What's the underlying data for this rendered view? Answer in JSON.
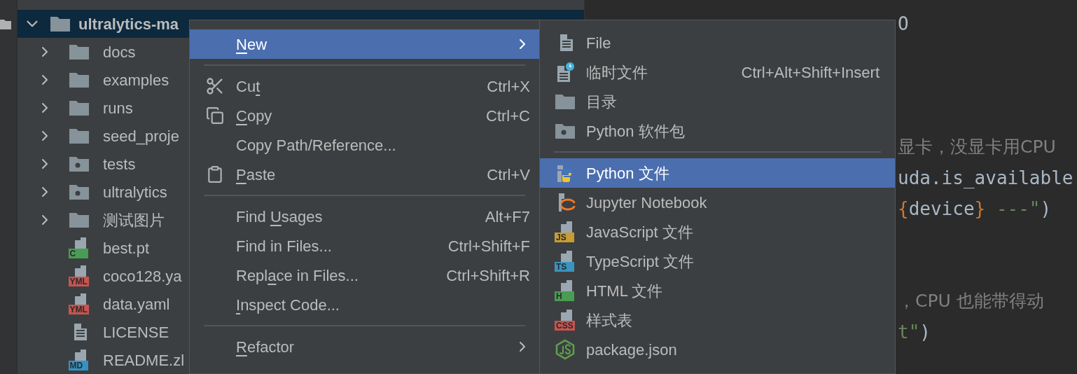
{
  "tree": {
    "root": {
      "label": "ultralytics-ma",
      "expanded": true,
      "selected": true
    },
    "children": [
      {
        "label": "docs",
        "kind": "folder",
        "expanded": false
      },
      {
        "label": "examples",
        "kind": "folder",
        "expanded": false
      },
      {
        "label": "runs",
        "kind": "folder",
        "expanded": false
      },
      {
        "label": "seed_proje",
        "kind": "folder",
        "expanded": false
      },
      {
        "label": "tests",
        "kind": "package",
        "expanded": false
      },
      {
        "label": "ultralytics",
        "kind": "package",
        "expanded": false
      },
      {
        "label": "测试图片",
        "kind": "folder",
        "expanded": false
      },
      {
        "label": "best.pt",
        "kind": "badged",
        "badge": "C",
        "color": "#499c54"
      },
      {
        "label": "coco128.ya",
        "kind": "badged",
        "badge": "YML",
        "color": "#c75450"
      },
      {
        "label": "data.yaml",
        "kind": "badged",
        "badge": "YML",
        "color": "#c75450"
      },
      {
        "label": "LICENSE",
        "kind": "text"
      },
      {
        "label": "README.zl",
        "kind": "badged",
        "badge": "MD",
        "color": "#3592c4"
      }
    ]
  },
  "editor": {
    "lines": [
      [
        {
          "text": "O",
          "kind": "plain"
        }
      ],
      [
        {
          "text": "显卡，没显卡用CPU",
          "kind": "comment"
        }
      ],
      [
        {
          "text": "uda.is_available",
          "kind": "plain"
        }
      ],
      [
        {
          "text": "{",
          "kind": "brace"
        },
        {
          "text": "device",
          "kind": "plain"
        },
        {
          "text": "}",
          "kind": "brace"
        },
        {
          "text": " ---\"",
          "kind": "string"
        },
        {
          "text": ")",
          "kind": "plain"
        }
      ],
      [
        {
          "text": "，CPU 也能带得动",
          "kind": "comment"
        }
      ],
      [
        {
          "text": "t\"",
          "kind": "string"
        },
        {
          "text": ")",
          "kind": "plain"
        }
      ]
    ]
  },
  "context_menu": [
    {
      "kind": "submenu",
      "label": [
        {
          "text": "N",
          "underlined": true
        },
        {
          "text": "ew",
          "underlined": false
        }
      ],
      "selected": true
    },
    {
      "kind": "separator"
    },
    {
      "kind": "cut",
      "label": [
        {
          "text": "Cu",
          "underlined": false
        },
        {
          "text": "t",
          "underlined": true
        }
      ],
      "shortcut": "Ctrl+X",
      "selected": false
    },
    {
      "kind": "copy",
      "label": [
        {
          "text": "C",
          "underlined": true
        },
        {
          "text": "opy",
          "underlined": false
        }
      ],
      "shortcut": "Ctrl+C",
      "selected": false
    },
    {
      "kind": "plain",
      "label": [
        {
          "text": "Copy Path/Reference...",
          "underlined": false
        }
      ],
      "selected": false
    },
    {
      "kind": "paste",
      "label": [
        {
          "text": "P",
          "underlined": true
        },
        {
          "text": "aste",
          "underlined": false
        }
      ],
      "shortcut": "Ctrl+V",
      "selected": false
    },
    {
      "kind": "separator"
    },
    {
      "kind": "plain",
      "label": [
        {
          "text": "Find ",
          "underlined": false
        },
        {
          "text": "U",
          "underlined": true
        },
        {
          "text": "sages",
          "underlined": false
        }
      ],
      "shortcut": "Alt+F7",
      "selected": false
    },
    {
      "kind": "plain",
      "label": [
        {
          "text": "Find in Files...",
          "underlined": false
        }
      ],
      "shortcut": "Ctrl+Shift+F",
      "selected": false
    },
    {
      "kind": "plain",
      "label": [
        {
          "text": "Repl",
          "underlined": false
        },
        {
          "text": "a",
          "underlined": true
        },
        {
          "text": "ce in Files...",
          "underlined": false
        }
      ],
      "shortcut": "Ctrl+Shift+R",
      "selected": false
    },
    {
      "kind": "plain",
      "label": [
        {
          "text": "I",
          "underlined": true
        },
        {
          "text": "nspect Code...",
          "underlined": false
        }
      ],
      "selected": false
    },
    {
      "kind": "separator"
    },
    {
      "kind": "submenu",
      "label": [
        {
          "text": "R",
          "underlined": true
        },
        {
          "text": "efactor",
          "underlined": false
        }
      ],
      "selected": false
    }
  ],
  "new_submenu": [
    {
      "kind": "file",
      "label": "File",
      "selected": false
    },
    {
      "kind": "scratch",
      "label": "临时文件",
      "shortcut": "Ctrl+Alt+Shift+Insert",
      "selected": false
    },
    {
      "kind": "directory",
      "label": "目录",
      "selected": false
    },
    {
      "kind": "package",
      "label": "Python 软件包",
      "selected": false
    },
    {
      "kind": "separator"
    },
    {
      "kind": "python",
      "label": "Python 文件",
      "selected": true
    },
    {
      "kind": "jupyter",
      "label": "Jupyter Notebook",
      "selected": false
    },
    {
      "kind": "badged",
      "label": "JavaScript 文件",
      "badge": "JS",
      "color": "#c69c33",
      "selected": false
    },
    {
      "kind": "badged",
      "label": "TypeScript 文件",
      "badge": "TS",
      "color": "#3a94c0",
      "selected": false
    },
    {
      "kind": "badged",
      "label": "HTML 文件",
      "badge": "H",
      "color": "#499c54",
      "selected": false
    },
    {
      "kind": "badged",
      "label": "样式表",
      "badge": "CSS",
      "color": "#c75450",
      "selected": false
    },
    {
      "kind": "node",
      "label": "package.json",
      "selected": false
    }
  ]
}
